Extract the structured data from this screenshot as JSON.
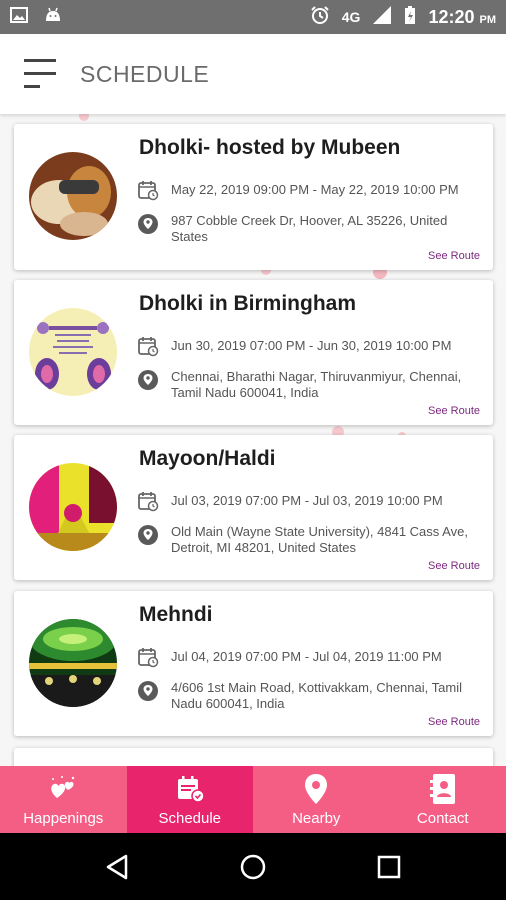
{
  "status_bar": {
    "network": "4G",
    "time": "12:20",
    "ampm": "PM"
  },
  "app_bar": {
    "title": "SCHEDULE"
  },
  "events": [
    {
      "title": "Dholki- hosted by Mubeen",
      "datetime": "May 22, 2019 09:00 PM - May 22, 2019 10:00 PM",
      "address": "987 Cobble Creek Dr, Hoover, AL  35226, United States",
      "route_label": "See Route"
    },
    {
      "title": "Dholki in Birmingham",
      "datetime": "Jun 30, 2019 07:00 PM - Jun 30, 2019 10:00 PM",
      "address": "Chennai, Bharathi Nagar, Thiruvanmiyur, Chennai, Tamil Nadu 600041, India",
      "route_label": "See Route"
    },
    {
      "title": "Mayoon/Haldi",
      "datetime": "Jul 03, 2019 07:00 PM - Jul 03, 2019 10:00 PM",
      "address": "Old Main (Wayne State University), 4841 Cass Ave, Detroit, MI  48201, United States",
      "route_label": "See Route"
    },
    {
      "title": "Mehndi",
      "datetime": "Jul 04, 2019 07:00 PM - Jul 04, 2019 11:00 PM",
      "address": "4/606 1st Main Road, Kottivakkam, Chennai, Tamil Nadu 600041, India",
      "route_label": "See Route"
    }
  ],
  "bottom_nav": [
    {
      "label": "Happenings",
      "icon": "hearts-icon"
    },
    {
      "label": "Schedule",
      "icon": "calendar-check-icon"
    },
    {
      "label": "Nearby",
      "icon": "location-pin-icon"
    },
    {
      "label": "Contact",
      "icon": "contact-book-icon"
    }
  ],
  "colors": {
    "nav_bg": "#f55e84",
    "nav_active": "#e8246d",
    "route_link": "#7b2a7f"
  }
}
